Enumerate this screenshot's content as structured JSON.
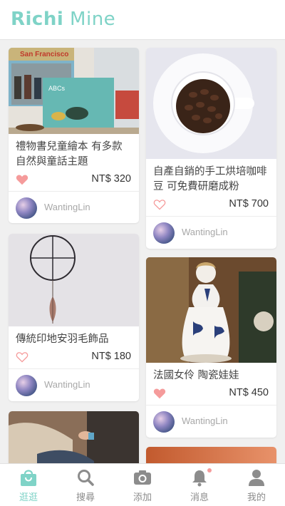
{
  "app": {
    "logo_bold": "Richi",
    "logo_light": "Mine",
    "accent_color": "#7fd3c7",
    "heart_color": "#f59b9b"
  },
  "feed": {
    "left": [
      {
        "title": "禮物書兒童繪本 有多款自然與童話主題",
        "price": "NT$ 320",
        "liked": true,
        "user": "WantingLin",
        "image": "books-photo"
      },
      {
        "title": "傳統印地安羽毛飾品",
        "price": "NT$ 180",
        "liked": false,
        "user": "WantingLin",
        "image": "dreamcatcher-photo"
      },
      {
        "title": "",
        "price": "",
        "liked": false,
        "user": "",
        "image": "knitting-photo"
      }
    ],
    "right": [
      {
        "title": "自產自銷的手工烘培咖啡豆 可免費研磨成粉",
        "price": "NT$ 700",
        "liked": false,
        "user": "WantingLin",
        "image": "coffee-beans-photo"
      },
      {
        "title": "法國女伶 陶瓷娃娃",
        "price": "NT$ 450",
        "liked": true,
        "user": "WantingLin",
        "image": "porcelain-doll-photo"
      },
      {
        "title": "",
        "price": "",
        "liked": false,
        "user": "",
        "image": "orange-photo"
      }
    ]
  },
  "tabs": [
    {
      "label": "逛逛",
      "icon": "shopping-bag-icon",
      "active": true
    },
    {
      "label": "搜尋",
      "icon": "search-icon",
      "active": false
    },
    {
      "label": "添加",
      "icon": "camera-icon",
      "active": false
    },
    {
      "label": "消息",
      "icon": "bell-icon",
      "active": false,
      "badge": true
    },
    {
      "label": "我的",
      "icon": "person-icon",
      "active": false
    }
  ]
}
